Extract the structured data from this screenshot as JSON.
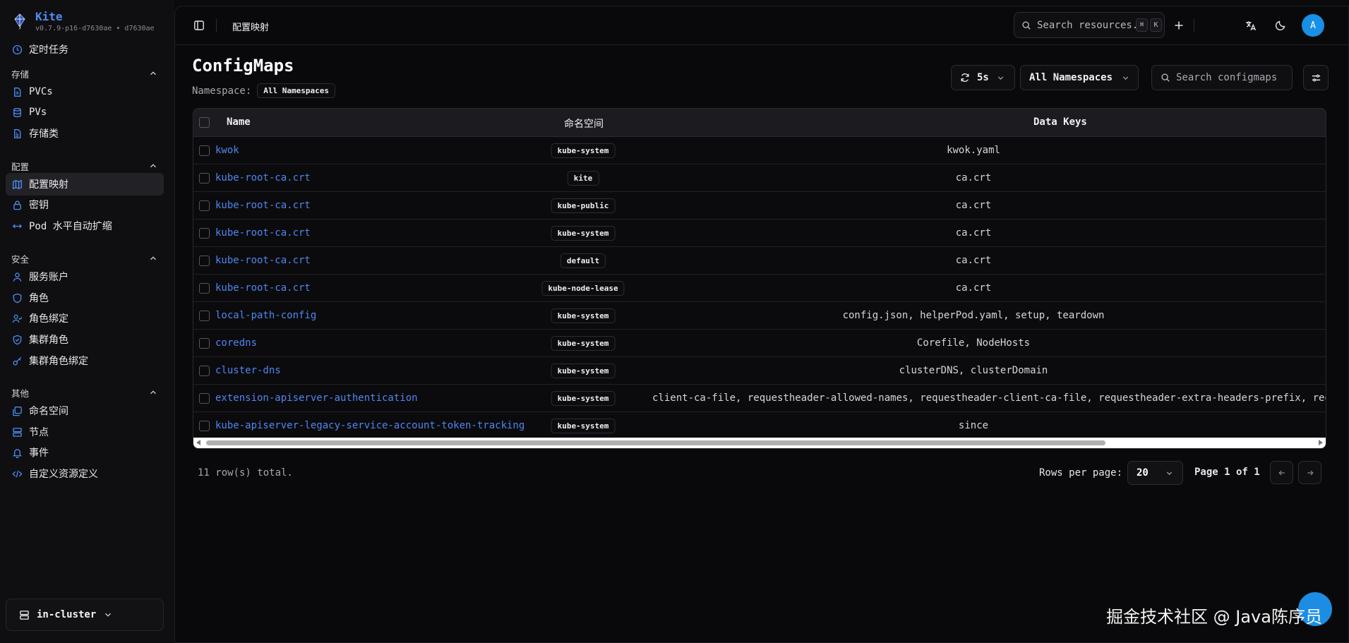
{
  "brand": {
    "name": "Kite",
    "version": "v0.7.9-p16-d7630ae • d7630ae"
  },
  "sidebar": {
    "top_items": [
      {
        "label": "定时任务",
        "icon": "clock-icon"
      }
    ],
    "sections": [
      {
        "title": "存储",
        "items": [
          {
            "label": "PVCs",
            "icon": "file-icon"
          },
          {
            "label": "PVs",
            "icon": "database-icon"
          },
          {
            "label": "存储类",
            "icon": "file-text-icon"
          }
        ]
      },
      {
        "title": "配置",
        "items": [
          {
            "label": "配置映射",
            "icon": "map-icon",
            "active": true
          },
          {
            "label": "密钥",
            "icon": "lock-icon"
          },
          {
            "label": "Pod 水平自动扩缩",
            "icon": "arrows-horizontal-icon"
          }
        ]
      },
      {
        "title": "安全",
        "items": [
          {
            "label": "服务账户",
            "icon": "user-icon"
          },
          {
            "label": "角色",
            "icon": "shield-icon"
          },
          {
            "label": "角色绑定",
            "icon": "user-check-icon"
          },
          {
            "label": "集群角色",
            "icon": "shield-check-icon"
          },
          {
            "label": "集群角色绑定",
            "icon": "key-icon"
          }
        ]
      },
      {
        "title": "其他",
        "items": [
          {
            "label": "命名空间",
            "icon": "layers-icon"
          },
          {
            "label": "节点",
            "icon": "server-icon"
          },
          {
            "label": "事件",
            "icon": "bell-icon"
          },
          {
            "label": "自定义资源定义",
            "icon": "code-icon"
          }
        ]
      }
    ],
    "cluster": "in-cluster"
  },
  "topbar": {
    "breadcrumb": "配置映射",
    "search_placeholder": "Search resources...",
    "kbd_keys": [
      "⌘",
      "K"
    ],
    "avatar_initial": "A"
  },
  "page": {
    "title": "ConfigMaps",
    "namespace_label": "Namespace:",
    "namespace_value": "All Namespaces",
    "refresh_interval": "5s",
    "namespace_select": "All Namespaces",
    "search_placeholder": "Search configmaps"
  },
  "table": {
    "headers": {
      "name": "Name",
      "namespace": "命名空间",
      "data_keys": "Data Keys"
    },
    "rows": [
      {
        "name": "kwok",
        "namespace": "kube-system",
        "keys": "kwok.yaml"
      },
      {
        "name": "kube-root-ca.crt",
        "namespace": "kite",
        "keys": "ca.crt"
      },
      {
        "name": "kube-root-ca.crt",
        "namespace": "kube-public",
        "keys": "ca.crt"
      },
      {
        "name": "kube-root-ca.crt",
        "namespace": "kube-system",
        "keys": "ca.crt"
      },
      {
        "name": "kube-root-ca.crt",
        "namespace": "default",
        "keys": "ca.crt"
      },
      {
        "name": "kube-root-ca.crt",
        "namespace": "kube-node-lease",
        "keys": "ca.crt"
      },
      {
        "name": "local-path-config",
        "namespace": "kube-system",
        "keys": "config.json, helperPod.yaml, setup, teardown"
      },
      {
        "name": "coredns",
        "namespace": "kube-system",
        "keys": "Corefile, NodeHosts"
      },
      {
        "name": "cluster-dns",
        "namespace": "kube-system",
        "keys": "clusterDNS, clusterDomain"
      },
      {
        "name": "extension-apiserver-authentication",
        "namespace": "kube-system",
        "keys": "client-ca-file, requestheader-allowed-names, requestheader-client-ca-file, requestheader-extra-headers-prefix, reque"
      },
      {
        "name": "kube-apiserver-legacy-service-account-token-tracking",
        "namespace": "kube-system",
        "keys": "since"
      }
    ]
  },
  "footer": {
    "row_count": "11 row(s) total.",
    "rows_per_page_label": "Rows per page:",
    "rows_per_page": "20",
    "page_info": "Page 1 of 1"
  },
  "watermark": "掘金技术社区 @ Java陈序员",
  "colors": {
    "accent": "#4f86f0",
    "brand": "#4d8cf5",
    "avatar": "#1790e6"
  }
}
